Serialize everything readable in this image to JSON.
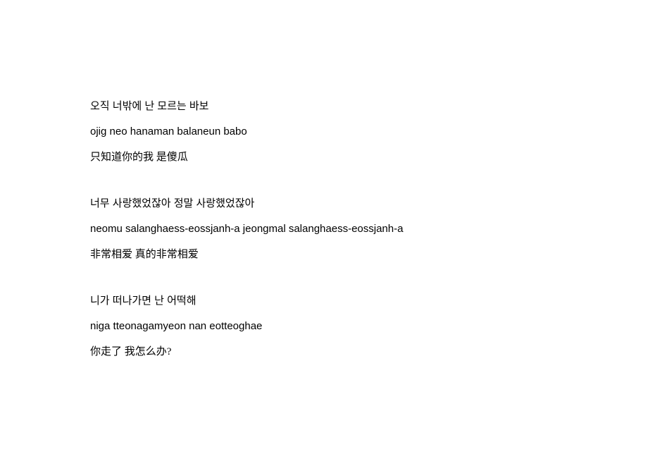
{
  "stanzas": [
    {
      "korean": "오직 너밖에 난 모르는 바보",
      "roman": "ojig neo hanaman balaneun babo",
      "chinese": "只知道你的我 是傻瓜"
    },
    {
      "korean": "너무 사랑했었잖아 정말 사랑했었잖아",
      "roman": "neomu salanghaess-eossjanh-a jeongmal salanghaess-eossjanh-a",
      "chinese": "非常相爱 真的非常相爱"
    },
    {
      "korean": "니가 떠나가면 난 어떡해",
      "roman": "niga tteonagamyeon nan eotteoghae",
      "chinese": "你走了 我怎么办?"
    }
  ]
}
